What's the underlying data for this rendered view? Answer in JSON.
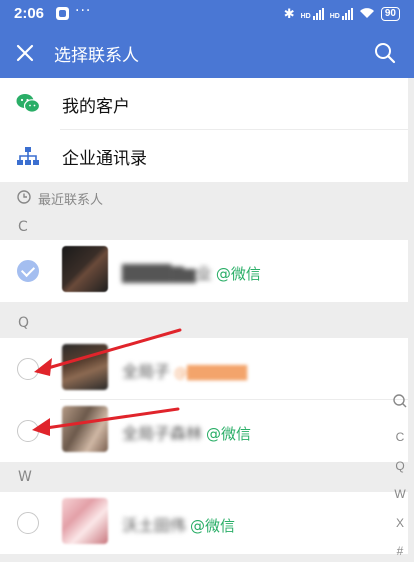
{
  "status_bar": {
    "time": "2:06",
    "dots": "···",
    "battery": "90",
    "network1": "HD",
    "network2": "HD"
  },
  "header": {
    "title": "选择联系人"
  },
  "menu": [
    {
      "label": "我的客户",
      "icon": "wechat-icon"
    },
    {
      "label": "企业通讯录",
      "icon": "org-chart-icon"
    }
  ],
  "recent_section": {
    "label": "最近联系人"
  },
  "groups": [
    {
      "letter": "C",
      "contacts": [
        {
          "name": "████▇▆业",
          "tag": "@微信",
          "checked": true
        }
      ]
    },
    {
      "letter": "Q",
      "contacts": [
        {
          "name": "全局子",
          "tag": "@██████",
          "checked": false
        },
        {
          "name": "全局子森林",
          "tag": "@微信",
          "checked": false
        }
      ]
    },
    {
      "letter": "W",
      "contacts": [
        {
          "name": "沃土田伟",
          "tag": "@微信",
          "checked": false
        }
      ]
    }
  ],
  "index_bar": [
    "C",
    "Q",
    "W",
    "X",
    "#"
  ],
  "colors": {
    "header_bg": "#4a77d4",
    "wechat_green": "#2aae67",
    "org_blue": "#3b6fd0",
    "annotation_red": "#e0242b"
  }
}
